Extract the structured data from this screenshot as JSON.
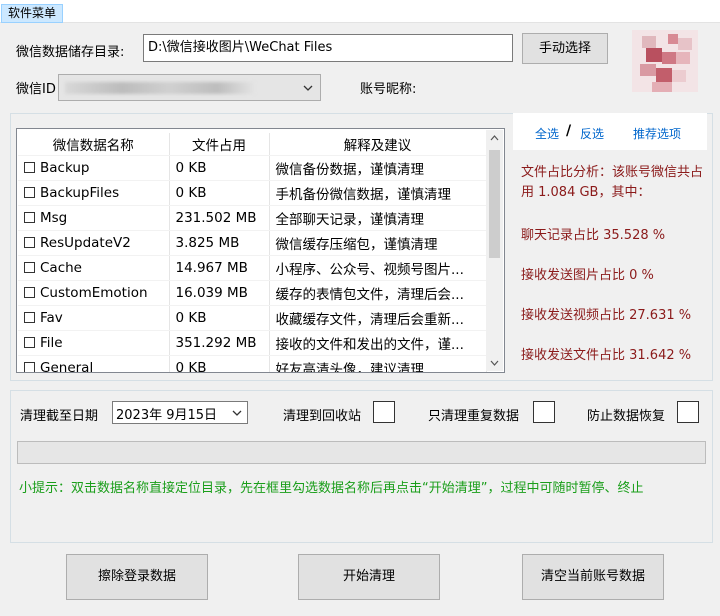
{
  "menu": {
    "label": "软件菜单"
  },
  "storage": {
    "label": "微信数据储存目录:",
    "path": "D:\\微信接收图片\\WeChat Files",
    "choose_button": "手动选择"
  },
  "account": {
    "wechat_id_label": "微信ID",
    "nickname_label": "账号昵称:"
  },
  "table": {
    "headers": [
      "微信数据名称",
      "文件占用",
      "解释及建议"
    ],
    "rows": [
      {
        "name": "Backup",
        "size": "0 KB",
        "note": "微信备份数据，谨慎清理"
      },
      {
        "name": "BackupFiles",
        "size": "0 KB",
        "note": "手机备份微信数据，谨慎清理"
      },
      {
        "name": "Msg",
        "size": "231.502 MB",
        "note": "全部聊天记录，谨慎清理"
      },
      {
        "name": "ResUpdateV2",
        "size": "3.825 MB",
        "note": "微信缓存压缩包，谨慎清理"
      },
      {
        "name": "Cache",
        "size": "14.967 MB",
        "note": "小程序、公众号、视频号图片..."
      },
      {
        "name": "CustomEmotion",
        "size": "16.039 MB",
        "note": "缓存的表情包文件，清理后会..."
      },
      {
        "name": "Fav",
        "size": "0 KB",
        "note": "收藏缓存文件，清理后会重新..."
      },
      {
        "name": "File",
        "size": "351.292 MB",
        "note": "接收的文件和发出的文件，谨..."
      },
      {
        "name": "General",
        "size": "0 KB",
        "note": "好友高清头像，建议清理"
      }
    ]
  },
  "selection": {
    "select_all": "全选",
    "separator": "/",
    "invert": "反选",
    "recommended": "推荐选项"
  },
  "analysis": {
    "summary": "文件占比分析：该账号微信共占用 1.084 GB，其中：",
    "chat": "聊天记录占比 35.528 %",
    "images": "接收发送图片占比 0 %",
    "videos": "接收发送视频占比 27.631 %",
    "files": "接收发送文件占比 31.642 %"
  },
  "options": {
    "date_label": "清理截至日期",
    "date_value": "2023年  9月15日",
    "recycle_label": "清理到回收站",
    "duplicates_label": "只清理重复数据",
    "prevent_recovery_label": "防止数据恢复"
  },
  "progress": {
    "value": 0
  },
  "tip": "小提示：双击数据名称直接定位目录，先在框里勾选数据名称后再点击“开始清理”，过程中可随时暂停、终止",
  "buttons": {
    "erase_login": "擦除登录数据",
    "start_clean": "开始清理",
    "clear_account": "清空当前账号数据"
  },
  "colors": {
    "analysis_text": "#8b1a1a",
    "tip_text": "#1a9e1a",
    "link": "#0066cc"
  }
}
